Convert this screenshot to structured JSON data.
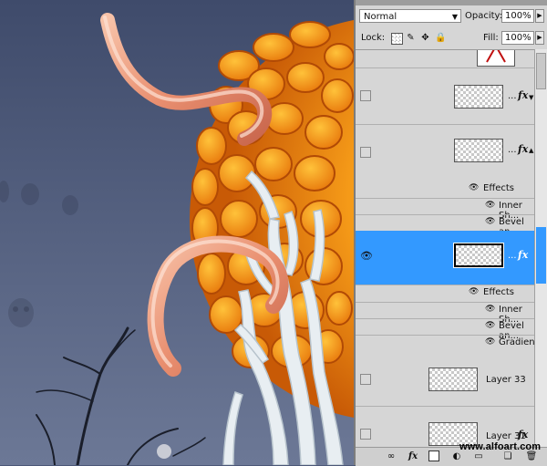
{
  "panel": {
    "blend_mode": "Normal",
    "opacity_label": "Opacity:",
    "opacity_value": "100%",
    "lock_label": "Lock:",
    "fill_label": "Fill:",
    "fill_value": "100%"
  },
  "layers": {
    "row1": {
      "name": "...",
      "fx": "fx"
    },
    "row2": {
      "name": "...",
      "fx": "fx"
    },
    "row2_effects": {
      "header": "Effects",
      "items": [
        "Inner Sh...",
        "Bevel an..."
      ]
    },
    "row3": {
      "name": "...",
      "fx": "fx"
    },
    "row3_effects": {
      "header": "Effects",
      "items": [
        "Inner Sh...",
        "Bevel an...",
        "Gradient ..."
      ]
    },
    "row4": {
      "name": "Layer 33"
    },
    "row5": {
      "name": "Layer 31",
      "fx": "fx"
    }
  },
  "icons": {
    "lock_transparent": "checker-square-icon",
    "lock_paint": "brush-icon",
    "lock_move": "move-icon",
    "lock_all": "padlock-icon",
    "bottom": [
      "link-icon",
      "fx-icon",
      "mask-icon",
      "adjustment-icon",
      "folder-icon",
      "new-layer-icon",
      "trash-icon"
    ]
  },
  "watermark": "www.alfoart.com",
  "colors": {
    "selected_row": "#3399ff",
    "panel_bg": "#d6d6d6",
    "canvas_bg": "#4c5878"
  }
}
